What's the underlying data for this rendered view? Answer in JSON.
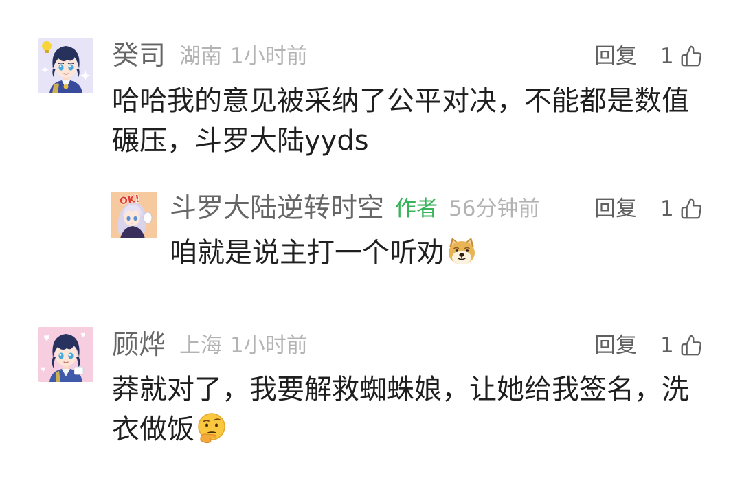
{
  "colors": {
    "background": "#ffffff",
    "text": "#1f1f1f",
    "username": "#666666",
    "meta": "#b3b3b3",
    "badge": "#37b35a",
    "action": "#606060"
  },
  "comments": [
    {
      "username": "癸司",
      "location": "湖南",
      "time": "1小时前",
      "reply_label": "回复",
      "likes": 1,
      "like_icon": "thumbs-up-icon",
      "text": "哈哈我的意见被采纳了公平对决，不能都是数值碾压，斗罗大陆yyds",
      "replies": [
        {
          "avatar": {
            "caption": "OK!"
          },
          "username": "斗罗大陆逆转时空",
          "badge": "作者",
          "time": "56分钟前",
          "reply_label": "回复",
          "likes": 1,
          "like_icon": "thumbs-up-icon",
          "text": "咱就是说主打一个听劝",
          "emoji": "doge"
        }
      ]
    },
    {
      "username": "顾烨",
      "location": "上海",
      "time": "1小时前",
      "reply_label": "回复",
      "likes": 1,
      "like_icon": "thumbs-up-icon",
      "text": "莽就对了，我要解救蜘蛛娘，让她给我签名，洗衣做饭",
      "emoji": "thinking-face"
    }
  ]
}
